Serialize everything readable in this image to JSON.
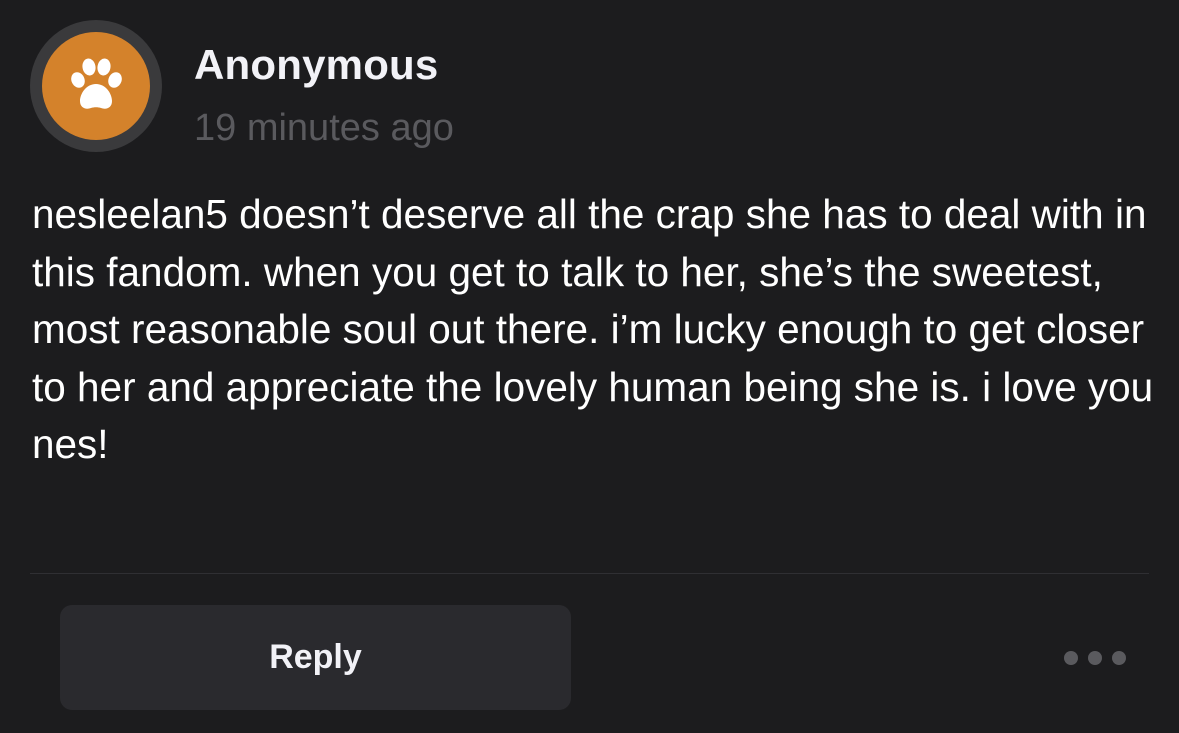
{
  "post": {
    "author": "Anonymous",
    "timestamp": "19 minutes ago",
    "avatar_icon": "paw-icon",
    "avatar_color": "#d4822b",
    "message": "nesleelan5 doesn’t deserve all the crap she has to deal with in this fandom. when you get to talk to her, she’s the sweetest, most reasonable soul out there. i’m lucky enough to get closer to her and appreciate the lovely human being she is. i love you nes!"
  },
  "actions": {
    "reply_label": "Reply",
    "more_icon": "more-dots-icon"
  }
}
